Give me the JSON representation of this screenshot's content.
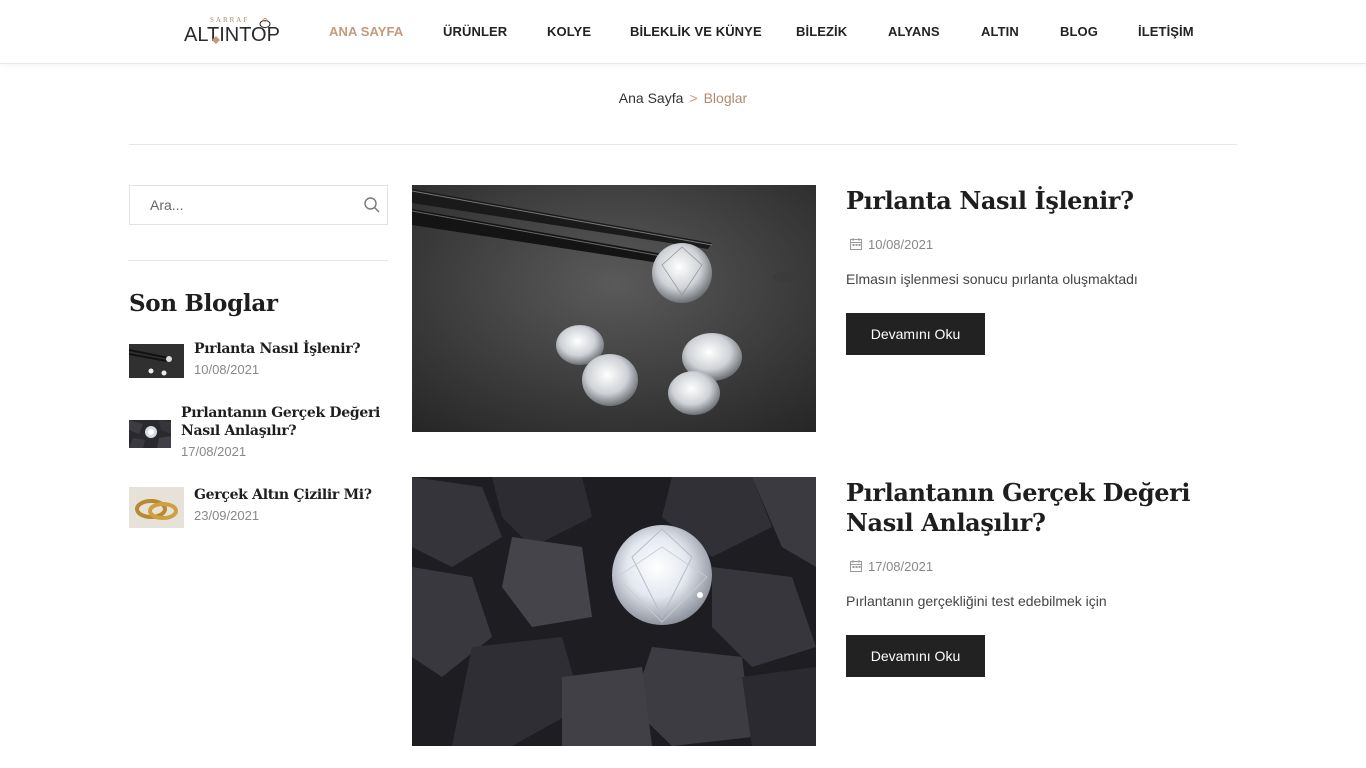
{
  "header": {
    "logo_small": "SARRAF",
    "logo_main": "ALTINTOP",
    "nav": [
      {
        "label": "ANA SAYFA",
        "active": true
      },
      {
        "label": "ÜRÜNLER",
        "active": false
      },
      {
        "label": "KOLYE",
        "active": false
      },
      {
        "label": "BİLEKLİK VE KÜNYE",
        "active": false
      },
      {
        "label": "BİLEZİK",
        "active": false
      },
      {
        "label": "ALYANS",
        "active": false
      },
      {
        "label": "ALTIN",
        "active": false
      },
      {
        "label": "BLOG",
        "active": false
      },
      {
        "label": "İLETİŞİM",
        "active": false
      }
    ]
  },
  "breadcrumb": {
    "home": "Ana Sayfa",
    "separator": ">",
    "current": "Bloglar"
  },
  "sidebar": {
    "search_placeholder": "Ara...",
    "search_icon": "search-icon",
    "recent_title": "Son Bloglar",
    "recent": [
      {
        "title": "Pırlanta Nasıl İşlenir?",
        "date": "10/08/2021",
        "thumb": "diamond-tweezers"
      },
      {
        "title": "Pırlantanın Gerçek Değeri Nasıl Anlaşılır?",
        "date": "17/08/2021",
        "thumb": "diamond-coal"
      },
      {
        "title": "Gerçek Altın Çizilir Mi?",
        "date": "23/09/2021",
        "thumb": "gold-rings"
      }
    ]
  },
  "posts": [
    {
      "title": "Pırlanta Nasıl İşlenir?",
      "date": "10/08/2021",
      "excerpt": "Elmasın işlenmesi sonucu pırlanta oluşmaktadı",
      "button": "Devamını Oku"
    },
    {
      "title": "Pırlantanın Gerçek Değeri Nasıl Anlaşılır?",
      "date": "17/08/2021",
      "excerpt": "Pırlantanın gerçekliğini test edebilmek için",
      "button": "Devamını Oku"
    }
  ],
  "colors": {
    "accent": "#c49a7c",
    "button_bg": "#222222",
    "text_dark": "#1e1e1e",
    "muted": "#888888"
  }
}
